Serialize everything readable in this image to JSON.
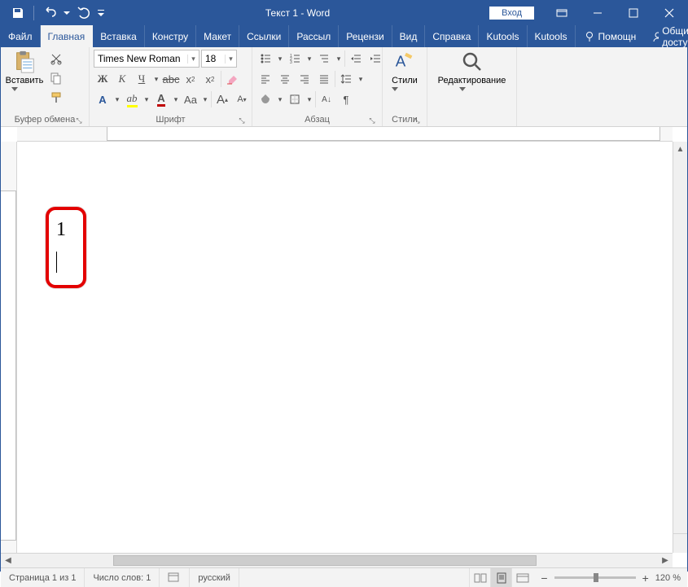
{
  "titlebar": {
    "title": "Текст 1  -  Word",
    "login": "Вход"
  },
  "tabs": {
    "file": "Файл",
    "home": "Главная",
    "insert": "Вставка",
    "design": "Констру",
    "layout": "Макет",
    "references": "Ссылки",
    "mailings": "Рассыл",
    "review": "Рецензи",
    "view": "Вид",
    "help": "Справка",
    "kutools": "Kutools",
    "kutools2": "Kutools",
    "tell_me": "Помощн",
    "share": "Общий доступ"
  },
  "ribbon": {
    "clipboard": {
      "label": "Буфер обмена",
      "paste": "Вставить"
    },
    "font": {
      "label": "Шрифт",
      "name": "Times New Roman",
      "size": "18"
    },
    "paragraph": {
      "label": "Абзац"
    },
    "styles": {
      "label": "Стили",
      "btn": "Стили"
    },
    "editing": {
      "label": "",
      "btn": "Редактирование"
    }
  },
  "document": {
    "text_line1": "1"
  },
  "status": {
    "page": "Страница 1 из 1",
    "words": "Число слов: 1",
    "language": "русский",
    "zoom": "120 %"
  }
}
